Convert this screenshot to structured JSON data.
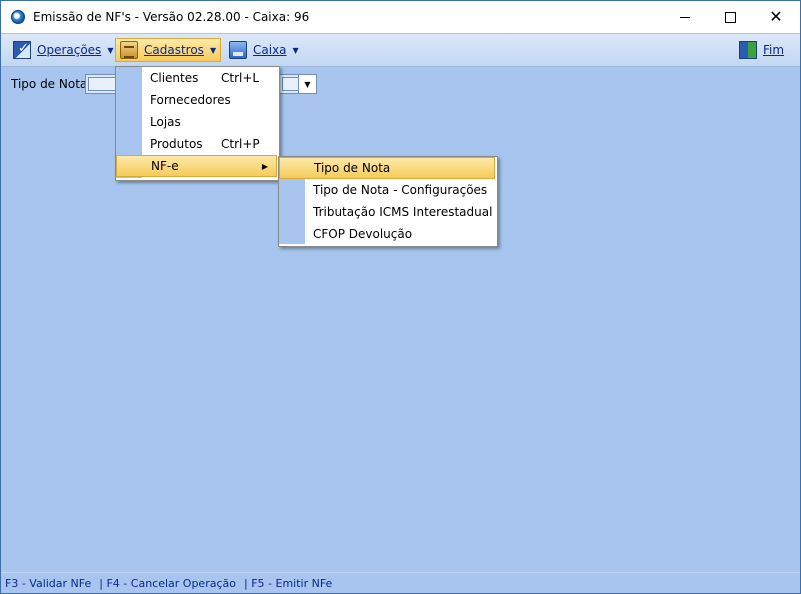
{
  "window": {
    "title": "Emissão de NF's - Versão 02.28.00 - Caixa: 96",
    "minimize_glyph": "",
    "close_glyph": "✕"
  },
  "menubar": {
    "operacoes": {
      "label": "Operações",
      "icon": "operations-icon"
    },
    "cadastros": {
      "label": "Cadastros",
      "icon": "cadastros-icon"
    },
    "caixa": {
      "label": "Caixa",
      "icon": "caixa-icon"
    },
    "fim": {
      "label": "Fim",
      "icon": "exit-icon"
    }
  },
  "filter": {
    "tipo_nota_label": "Tipo de Nota:",
    "tipo_nota_value": ""
  },
  "cadastros_menu": {
    "items": [
      {
        "label": "Clientes",
        "shortcut": "Ctrl+L"
      },
      {
        "label": "Fornecedores",
        "shortcut": ""
      },
      {
        "label": "Lojas",
        "shortcut": ""
      },
      {
        "label": "Produtos",
        "shortcut": "Ctrl+P"
      },
      {
        "label": "NF-e",
        "shortcut": ""
      }
    ],
    "active_item": "NF-e"
  },
  "nfe_submenu": {
    "items": [
      {
        "label": "Tipo de Nota"
      },
      {
        "label": "Tipo de Nota - Configurações"
      },
      {
        "label": "Tributação ICMS Interestadual"
      },
      {
        "label": "CFOP Devolução"
      }
    ],
    "active_item": "Tipo de Nota"
  },
  "statusbar": {
    "f3": "F3 - Validar NFe",
    "f4": "| F4 - Cancelar Operação",
    "f5": "| F5 - Emitir NFe"
  },
  "colors": {
    "background": "#a7c5ee",
    "highlight": "#f6cc5a",
    "menu_text": "#0a2a8a"
  }
}
